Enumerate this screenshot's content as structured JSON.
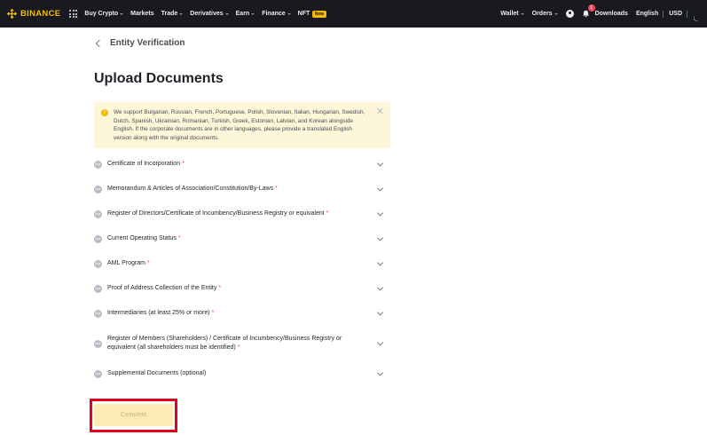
{
  "brand": {
    "name": "BINANCE",
    "color": "#f0b90b"
  },
  "nav": {
    "items": [
      {
        "label": "Buy Crypto",
        "dropdown": true
      },
      {
        "label": "Markets",
        "dropdown": false
      },
      {
        "label": "Trade",
        "dropdown": true
      },
      {
        "label": "Derivatives",
        "dropdown": true
      },
      {
        "label": "Earn",
        "dropdown": true
      },
      {
        "label": "Finance",
        "dropdown": true
      },
      {
        "label": "NFT",
        "dropdown": false,
        "badge": "New"
      }
    ],
    "right": {
      "wallet": "Wallet",
      "orders": "Orders",
      "notification_count": "1",
      "downloads": "Downloads",
      "language": "English",
      "currency": "USD"
    }
  },
  "breadcrumb": {
    "back_label": "Entity Verification"
  },
  "page": {
    "title": "Upload Documents"
  },
  "notice": {
    "text": "We support Bulgarian, Russian, French, Portuguese, Polish, Slovenian, Italian, Hungarian, Swedish, Dutch, Spanish, Ukrainian, Romanian, Turkish, Greek, Estonian, Latvian, and Korean alongside English. If the corporate documents are in other languages, please provide a translated English version along with the original documents."
  },
  "documents": [
    {
      "label": "Certificate of Incorporation",
      "required": true
    },
    {
      "label": "Memorandum & Articles of Association/Constitution/By-Laws",
      "required": true
    },
    {
      "label": "Register of Directors/Certificate of Incumbency/Business Registry or equivalent",
      "required": true
    },
    {
      "label": "Current Operating Status",
      "required": true
    },
    {
      "label": "AML Program",
      "required": true
    },
    {
      "label": "Proof of Address Collection of the Entity",
      "required": true
    },
    {
      "label": "Intermediaries (at least 25% or more)",
      "required": true
    },
    {
      "label": "Register of Members (Shareholders) / Certificate of Incumbency/Business Registry or equivalent (all shareholders must be identified)",
      "required": true
    },
    {
      "label": "Supplemental Documents (optional)",
      "required": false
    }
  ],
  "required_marker": "*",
  "actions": {
    "complete_label": "Complete"
  },
  "colors": {
    "accent": "#f0b90b",
    "required": "#f6465d",
    "highlight_box": "#e5001c",
    "topbar": "#181a20"
  }
}
